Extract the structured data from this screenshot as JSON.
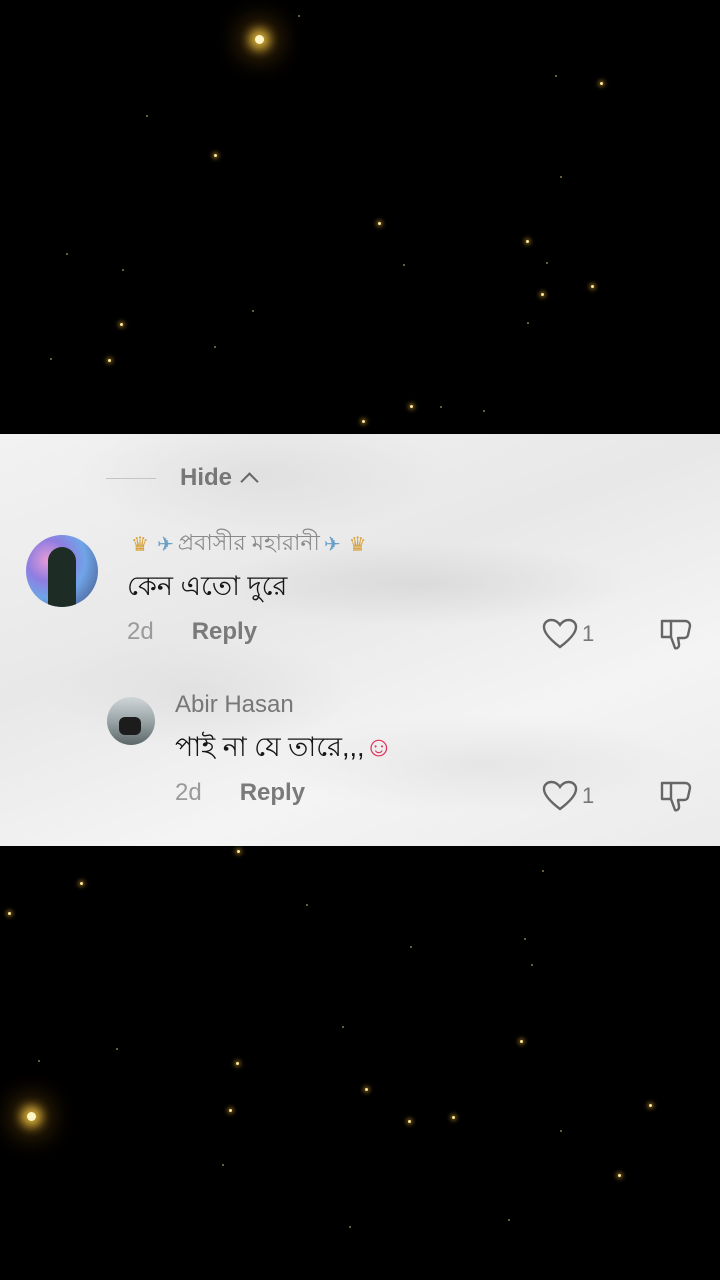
{
  "replies_control": {
    "hide_label": "Hide"
  },
  "comments": [
    {
      "username": "প্রবাসীর মহারানী",
      "text": "কেন এতো দুরে",
      "time": "2d",
      "reply_label": "Reply",
      "like_count": "1"
    },
    {
      "username": "Abir Hasan",
      "text": "পাই না যে তারে,,,",
      "time": "2d",
      "reply_label": "Reply",
      "like_count": "1"
    }
  ],
  "icons": {
    "hide": "chevron-up-icon",
    "like": "heart-outline-icon",
    "dislike": "thumbs-down-icon",
    "name_decorations": [
      "crown-icon",
      "airplane-icon"
    ],
    "reply_emoji": "smiling-face-with-hearts-icon"
  },
  "colors": {
    "background": "#000000",
    "panel": "#ededed",
    "sparkle": "#ffd25a"
  }
}
